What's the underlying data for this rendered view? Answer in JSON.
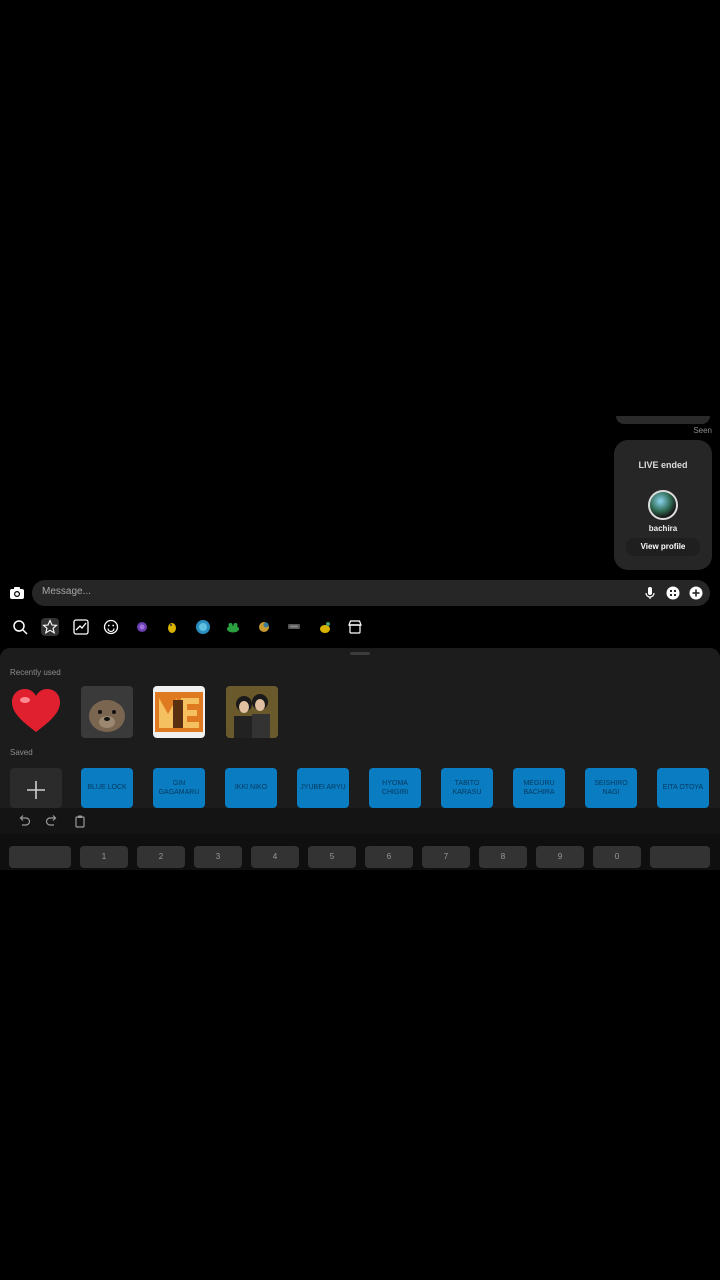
{
  "chat": {
    "seen": "Seen",
    "live_card": {
      "title": "LIVE ended",
      "username": "bachira",
      "button": "View profile"
    }
  },
  "composer": {
    "placeholder": "Message...",
    "icons": [
      "camera-icon",
      "microphone-icon",
      "sticker-grid-icon",
      "plus-icon"
    ]
  },
  "sticker_tabs": [
    "search-icon",
    "favorites-star-icon",
    "trending-icon",
    "emoji-icon",
    "sticker-pack-1",
    "sticker-pack-2",
    "sticker-pack-3",
    "sticker-pack-4",
    "sticker-pack-5",
    "sticker-pack-6",
    "sticker-pack-7",
    "store-icon"
  ],
  "sticker_panel": {
    "recent_label": "Recently used",
    "saved_label": "Saved",
    "recent": [
      {
        "name": "heart-sticker"
      },
      {
        "name": "dog-sticker"
      },
      {
        "name": "me-sticker"
      },
      {
        "name": "anime-duo-sticker"
      }
    ],
    "saved": [
      "BLUE LOCK",
      "GIN GAGAMARU",
      "IKKI NIKO",
      "JYUBEI ARYU",
      "HYOMA CHIGIRI",
      "TABITO KARASU",
      "MEGURU BACHIRA",
      "SEISHIRO NAGI",
      "EITA OTOYA"
    ]
  },
  "edit_toolbar": [
    "undo-icon",
    "redo-icon",
    "clipboard-icon"
  ],
  "keyboard": {
    "numbers": [
      "1",
      "2",
      "3",
      "4",
      "5",
      "6",
      "7",
      "8",
      "9",
      "0"
    ]
  },
  "colors": {
    "background": "#000000",
    "panel": "#1c1c1c",
    "saved_tile": "#0a7cc1",
    "input": "#262626"
  }
}
